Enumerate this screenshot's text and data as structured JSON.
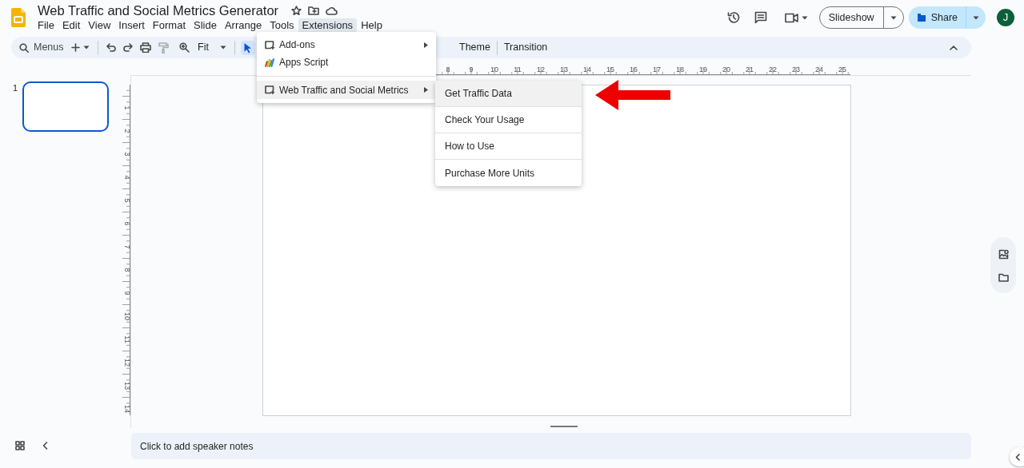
{
  "document": {
    "title": "Web Traffic and Social Metrics Generator"
  },
  "menubar": [
    {
      "label": "File",
      "selected": false
    },
    {
      "label": "Edit",
      "selected": false
    },
    {
      "label": "View",
      "selected": false
    },
    {
      "label": "Insert",
      "selected": false
    },
    {
      "label": "Format",
      "selected": false
    },
    {
      "label": "Slide",
      "selected": false
    },
    {
      "label": "Arrange",
      "selected": false
    },
    {
      "label": "Tools",
      "selected": false
    },
    {
      "label": "Extensions",
      "selected": true
    },
    {
      "label": "Help",
      "selected": false
    }
  ],
  "header": {
    "slideshow": "Slideshow",
    "share": "Share",
    "avatar": "J"
  },
  "toolbar": {
    "search_placeholder": "Menus",
    "zoom": "Fit",
    "tools": [
      {
        "kind": "undo",
        "disabled": false
      },
      {
        "kind": "redo",
        "disabled": false
      },
      {
        "kind": "print",
        "disabled": false
      },
      {
        "kind": "paint",
        "disabled": true
      }
    ],
    "select_active": true,
    "buttons": [
      "Theme",
      "Transition"
    ]
  },
  "ruler": {
    "horizontal": [
      "8",
      "9",
      "10",
      "11",
      "12",
      "13",
      "14",
      "15",
      "16",
      "17",
      "18",
      "19",
      "20",
      "21",
      "22",
      "23",
      "24",
      "25"
    ],
    "vertical": [
      "1",
      "2",
      "3",
      "4",
      "5",
      "6",
      "7",
      "8",
      "9",
      "10",
      "11",
      "12",
      "13",
      "14"
    ]
  },
  "slides": [
    {
      "number": "1",
      "selected": true
    }
  ],
  "extensions_menu": [
    {
      "label": "Add-ons",
      "kind": "addon",
      "submenu": true,
      "highlighted": false
    },
    {
      "label": "Apps Script",
      "kind": "script",
      "submenu": false,
      "highlighted": false
    },
    {
      "label": "Web Traffic and Social Metrics",
      "kind": "addon",
      "submenu": true,
      "highlighted": true
    }
  ],
  "submenu": [
    {
      "label": "Get Traffic Data",
      "highlighted": true
    },
    {
      "label": "Check Your Usage",
      "highlighted": false
    },
    {
      "label": "How to Use",
      "highlighted": false
    },
    {
      "label": "Purchase More Units",
      "highlighted": false
    }
  ],
  "notes": {
    "placeholder": "Click to add speaker notes"
  }
}
